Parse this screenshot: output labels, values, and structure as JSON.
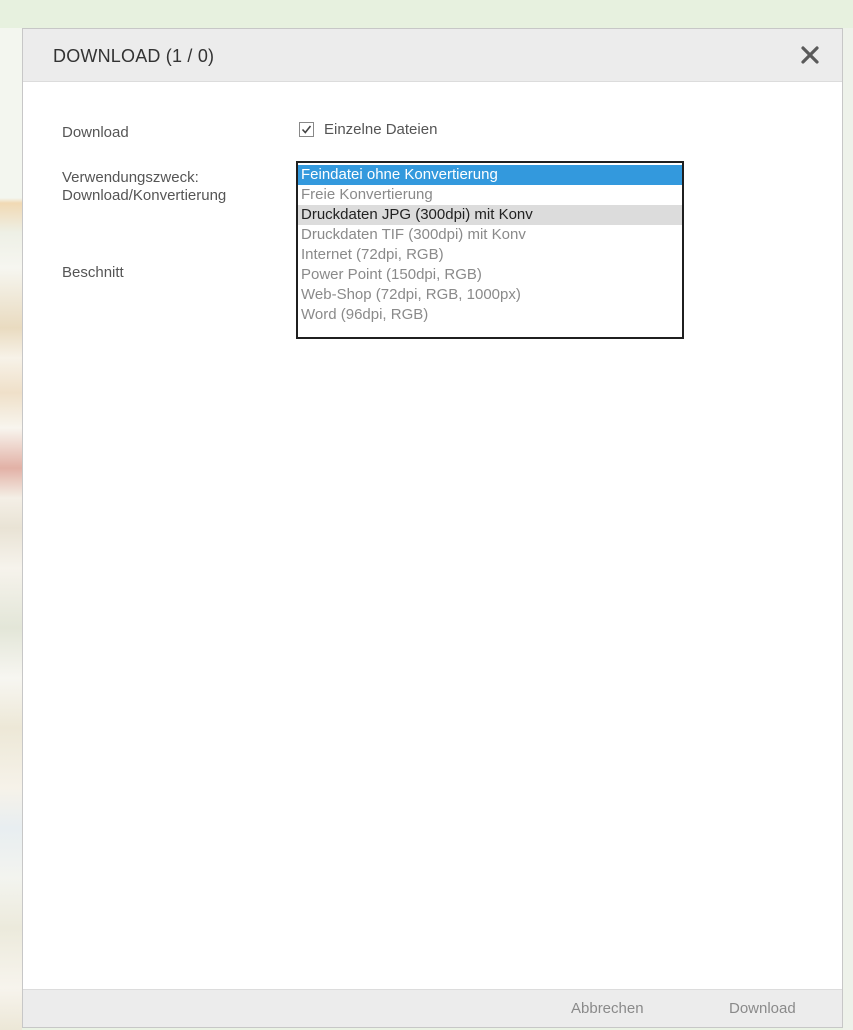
{
  "dialog": {
    "title": "DOWNLOAD (1 / 0)",
    "close_icon": "close-icon"
  },
  "form": {
    "download_label": "Download",
    "checkbox": {
      "label": "Einzelne Dateien",
      "checked": true
    },
    "usage_label_line1": "Verwendungszweck:",
    "usage_label_line2": "Download/Konvertierung",
    "crop_label": "Beschnitt"
  },
  "usage_options": [
    {
      "label": "Feindatei ohne Konvertierung",
      "state": "selected"
    },
    {
      "label": "Freie Konvertierung",
      "state": "normal"
    },
    {
      "label": "Druckdaten JPG (300dpi) mit Konv",
      "state": "hover"
    },
    {
      "label": "Druckdaten TIF (300dpi) mit Konv",
      "state": "normal"
    },
    {
      "label": "Internet (72dpi, RGB)",
      "state": "normal"
    },
    {
      "label": "Power Point (150dpi, RGB)",
      "state": "normal"
    },
    {
      "label": "Web-Shop (72dpi, RGB, 1000px)",
      "state": "normal"
    },
    {
      "label": "Word (96dpi, RGB)",
      "state": "normal"
    }
  ],
  "footer": {
    "cancel_label": "Abbrechen",
    "download_label": "Download"
  },
  "colors": {
    "selected_bg": "#3399dd",
    "hover_bg": "#dcdcdc",
    "header_bg": "#ececec"
  }
}
